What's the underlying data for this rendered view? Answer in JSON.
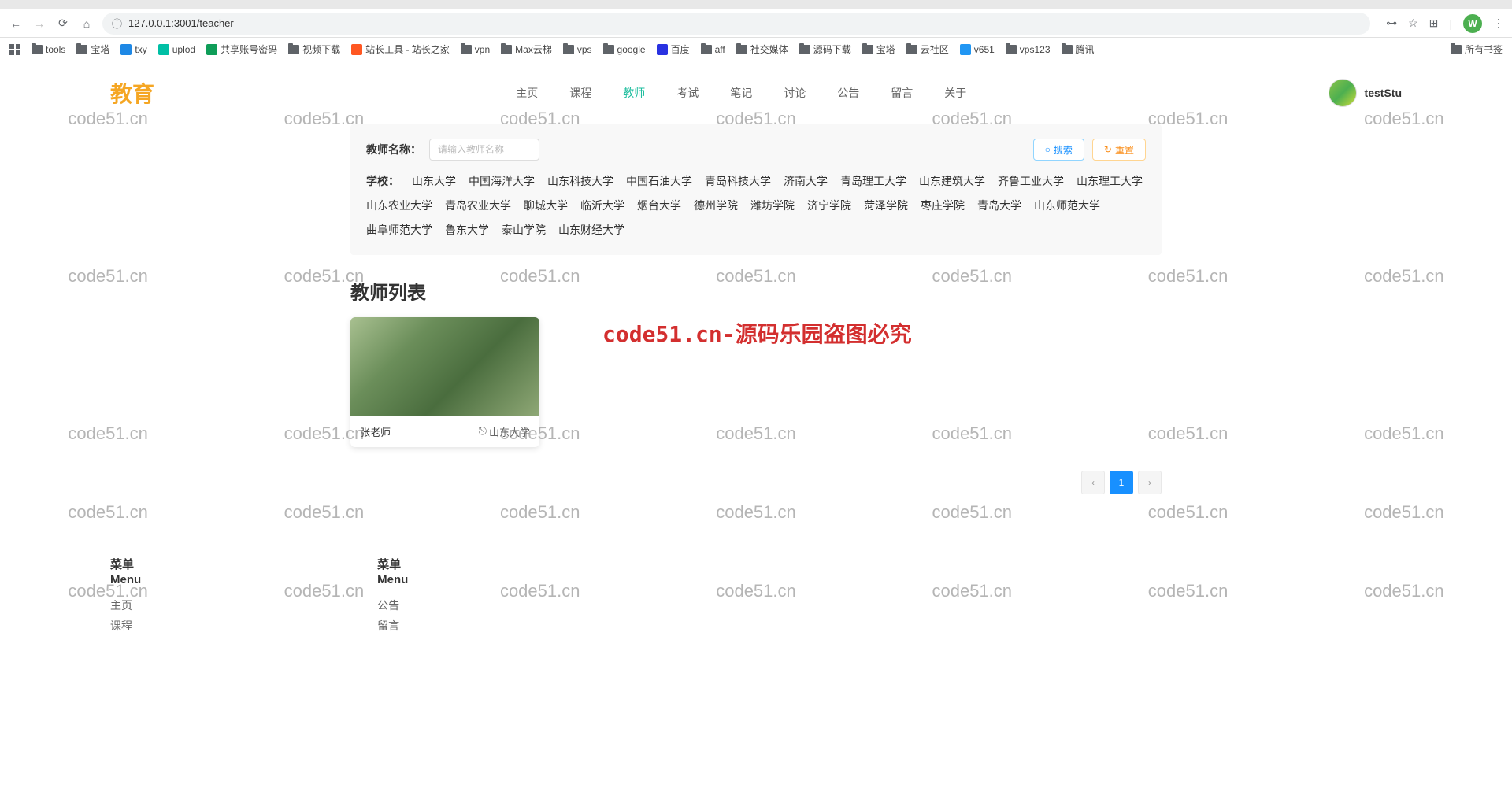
{
  "browser": {
    "url": "127.0.0.1:3001/teacher",
    "avatar_letter": "W"
  },
  "bookmarks": {
    "items": [
      {
        "label": "tools",
        "icon": "folder"
      },
      {
        "label": "宝塔",
        "icon": "folder"
      },
      {
        "label": "txy",
        "icon": "txy"
      },
      {
        "label": "uplod",
        "icon": "uplod"
      },
      {
        "label": "共享账号密码",
        "icon": "gongxiang"
      },
      {
        "label": "视频下载",
        "icon": "folder"
      },
      {
        "label": "站长工具 - 站长之家",
        "icon": "zhanzhang"
      },
      {
        "label": "vpn",
        "icon": "folder"
      },
      {
        "label": "Max云梯",
        "icon": "folder"
      },
      {
        "label": "vps",
        "icon": "folder"
      },
      {
        "label": "google",
        "icon": "folder"
      },
      {
        "label": "百度",
        "icon": "baidu"
      },
      {
        "label": "aff",
        "icon": "folder"
      },
      {
        "label": "社交媒体",
        "icon": "folder"
      },
      {
        "label": "源码下载",
        "icon": "folder"
      },
      {
        "label": "宝塔",
        "icon": "folder"
      },
      {
        "label": "云社区",
        "icon": "folder"
      },
      {
        "label": "v651",
        "icon": "v651"
      },
      {
        "label": "vps123",
        "icon": "folder"
      },
      {
        "label": "腾讯",
        "icon": "folder"
      }
    ],
    "all_label": "所有书签"
  },
  "page": {
    "logo": "教育",
    "nav": [
      "主页",
      "课程",
      "教师",
      "考试",
      "笔记",
      "讨论",
      "公告",
      "留言",
      "关于"
    ],
    "nav_active_index": 2,
    "user_name": "testStu",
    "filter": {
      "label": "教师名称：",
      "placeholder": "请输入教师名称",
      "search_btn": "搜索",
      "reset_btn": "重置",
      "school_label": "学校：",
      "schools": [
        "山东大学",
        "中国海洋大学",
        "山东科技大学",
        "中国石油大学",
        "青岛科技大学",
        "济南大学",
        "青岛理工大学",
        "山东建筑大学",
        "齐鲁工业大学",
        "山东理工大学",
        "山东农业大学",
        "青岛农业大学",
        "聊城大学",
        "临沂大学",
        "烟台大学",
        "德州学院",
        "潍坊学院",
        "济宁学院",
        "菏泽学院",
        "枣庄学院",
        "青岛大学",
        "山东师范大学",
        "曲阜师范大学",
        "鲁东大学",
        "泰山学院",
        "山东财经大学"
      ]
    },
    "list_title": "教师列表",
    "teacher": {
      "name": "张老师",
      "school": "山东大学"
    },
    "watermark_main": "code51.cn-源码乐园盗图必究",
    "watermark_bg": "code51.cn",
    "pagination": {
      "current": "1"
    },
    "footer": {
      "col1": {
        "title_cn": "菜单",
        "title_en": "Menu",
        "links": [
          "主页",
          "课程"
        ]
      },
      "col2": {
        "title_cn": "菜单",
        "title_en": "Menu",
        "links": [
          "公告",
          "留言"
        ]
      }
    }
  }
}
